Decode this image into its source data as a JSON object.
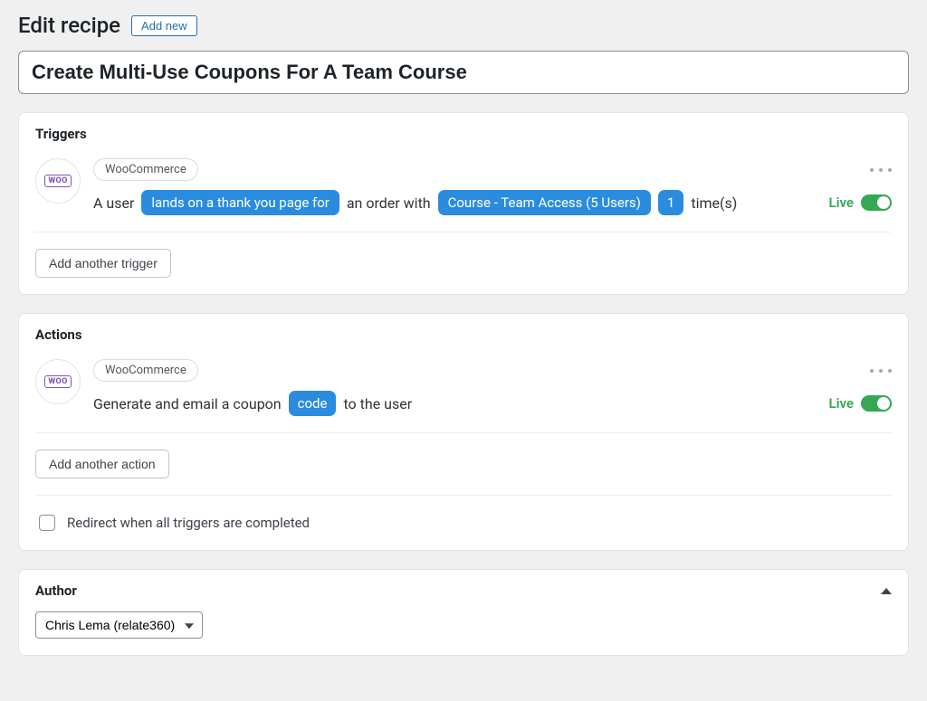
{
  "header": {
    "title": "Edit recipe",
    "add_new": "Add new"
  },
  "recipe": {
    "title": "Create Multi-Use Coupons For A Team Course"
  },
  "triggers": {
    "heading": "Triggers",
    "items": [
      {
        "integration": "WooCommerce",
        "icon_label": "WOO",
        "status": "Live",
        "sentence": {
          "p1": "A user",
          "t1": "lands on a thank you page for",
          "p2": "an order with",
          "t2": "Course - Team Access (5 Users)",
          "t3": "1",
          "p3": "time(s)"
        }
      }
    ],
    "add_button": "Add another trigger"
  },
  "actions": {
    "heading": "Actions",
    "items": [
      {
        "integration": "WooCommerce",
        "icon_label": "WOO",
        "status": "Live",
        "sentence": {
          "p1": "Generate and email a coupon",
          "t1": "code",
          "p2": "to the user"
        }
      }
    ],
    "add_button": "Add another action",
    "redirect_label": "Redirect when all triggers are completed"
  },
  "author": {
    "heading": "Author",
    "selected": "Chris Lema (relate360)"
  }
}
